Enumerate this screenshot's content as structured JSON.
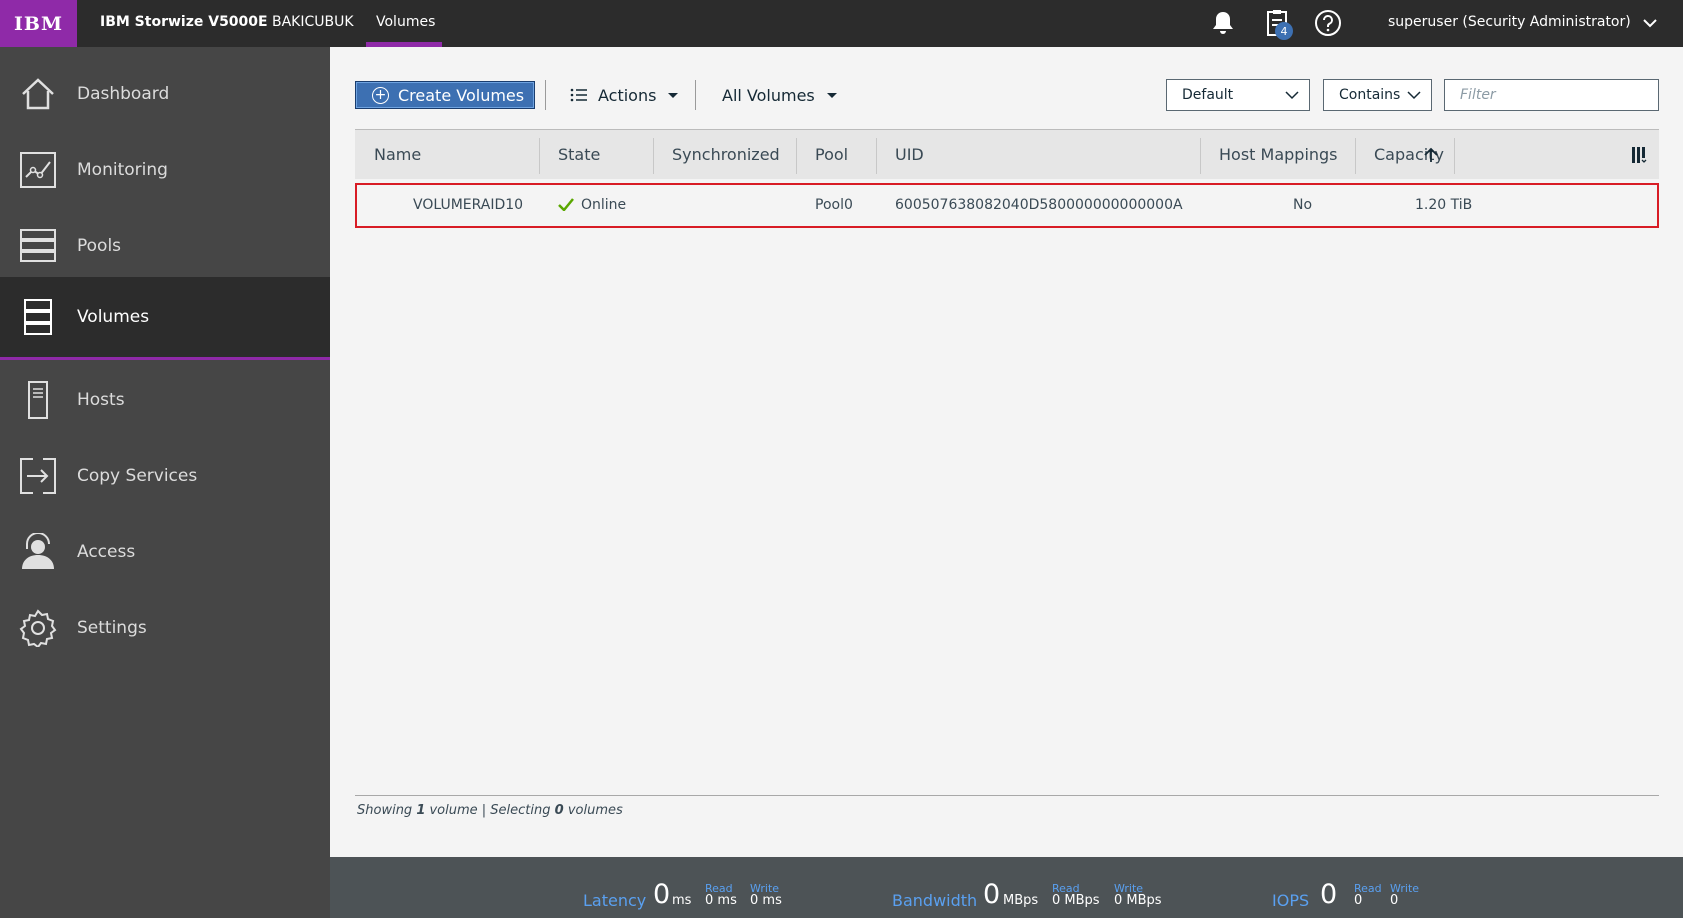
{
  "header": {
    "logo": "IBM",
    "product": "IBM Storwize V5000E",
    "system": "BAKICUBUK",
    "current_page": "Volumes",
    "tasks_badge": "4",
    "user": "superuser (Security Administrator)",
    "accent_color": "#8f2aa8"
  },
  "sidebar": {
    "items": [
      {
        "label": "Dashboard",
        "icon": "home-icon"
      },
      {
        "label": "Monitoring",
        "icon": "monitoring-icon"
      },
      {
        "label": "Pools",
        "icon": "pools-icon"
      },
      {
        "label": "Volumes",
        "icon": "volumes-icon",
        "active": true
      },
      {
        "label": "Hosts",
        "icon": "hosts-icon"
      },
      {
        "label": "Copy Services",
        "icon": "copy-services-icon"
      },
      {
        "label": "Access",
        "icon": "access-icon"
      },
      {
        "label": "Settings",
        "icon": "settings-icon"
      }
    ]
  },
  "toolbar": {
    "create_label": "Create Volumes",
    "actions_label": "Actions",
    "view_label": "All Volumes",
    "filter_scope": "Default",
    "filter_mode": "Contains",
    "filter_placeholder": "Filter"
  },
  "table": {
    "columns": [
      "Name",
      "State",
      "Synchronized",
      "Pool",
      "UID",
      "Host Mappings",
      "Capacity"
    ],
    "sort_column": "Capacity",
    "sort_direction": "ascending",
    "rows": [
      {
        "name": "VOLUMERAID10",
        "state": "Online",
        "synchronized": "",
        "pool": "Pool0",
        "uid": "600507638082040D580000000000000A",
        "host_mappings": "No",
        "capacity": "1.20 TiB"
      }
    ],
    "footer": {
      "showing_prefix": "Showing ",
      "showing_count": "1",
      "showing_mid": " volume | Selecting ",
      "selecting_count": "0",
      "selecting_suffix": " volumes"
    }
  },
  "performance": {
    "latency": {
      "label": "Latency",
      "value": "0",
      "unit": "ms",
      "read_label": "Read",
      "read": "0 ms",
      "write_label": "Write",
      "write": "0 ms"
    },
    "bandwidth": {
      "label": "Bandwidth",
      "value": "0",
      "unit": "MBps",
      "read_label": "Read",
      "read": "0 MBps",
      "write_label": "Write",
      "write": "0 MBps"
    },
    "iops": {
      "label": "IOPS",
      "value": "0",
      "read_label": "Read",
      "read": "0",
      "write_label": "Write",
      "write": "0"
    }
  }
}
